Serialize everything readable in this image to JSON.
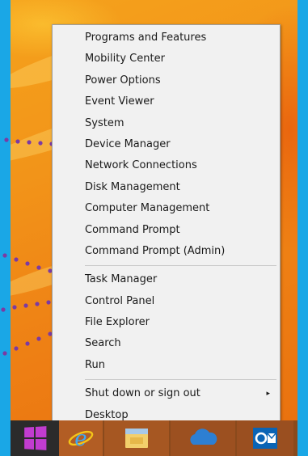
{
  "menu": {
    "groups": [
      [
        "Programs and Features",
        "Mobility Center",
        "Power Options",
        "Event Viewer",
        "System",
        "Device Manager",
        "Network Connections",
        "Disk Management",
        "Computer Management",
        "Command Prompt",
        "Command Prompt (Admin)"
      ],
      [
        "Task Manager",
        "Control Panel",
        "File Explorer",
        "Search",
        "Run"
      ],
      [
        "Shut down or sign out",
        "Desktop"
      ]
    ],
    "submenu_arrow": "▸"
  },
  "taskbar": {
    "apps": [
      {
        "name": "start-button",
        "icon": "windows-logo-icon"
      },
      {
        "name": "internet-explorer",
        "icon": "internet-explorer-icon"
      },
      {
        "name": "file-explorer",
        "icon": "file-explorer-icon"
      },
      {
        "name": "onedrive",
        "icon": "onedrive-icon"
      },
      {
        "name": "outlook",
        "icon": "outlook-icon"
      }
    ]
  },
  "colors": {
    "frame": "#1aa7e6",
    "wallpaper": "#f29419",
    "menu_bg": "#f1f1f1",
    "dot": "#7b3aa3",
    "start_logo": "#c13cd0"
  }
}
